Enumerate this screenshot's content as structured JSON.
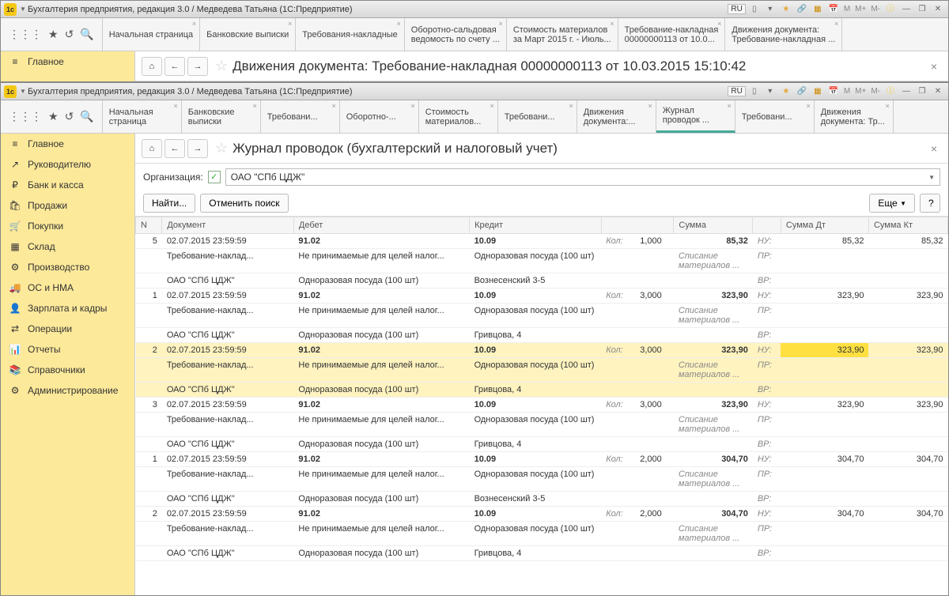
{
  "win1": {
    "title": "Бухгалтерия предприятия, редакция 3.0 / Медведева Татьяна  (1С:Предприятие)",
    "ru": "RU",
    "mem": [
      "M",
      "M+",
      "M-"
    ],
    "tabs": [
      {
        "l1": "Начальная страница",
        "l2": ""
      },
      {
        "l1": "Банковские выписки",
        "l2": ""
      },
      {
        "l1": "Требования-накладные",
        "l2": ""
      },
      {
        "l1": "Оборотно-сальдовая",
        "l2": "ведомость по счету ..."
      },
      {
        "l1": "Стоимость материалов",
        "l2": "за Март 2015 г. - Июль..."
      },
      {
        "l1": "Требование-накладная",
        "l2": "00000000113 от 10.0..."
      },
      {
        "l1": "Движения документа:",
        "l2": "Требование-накладная ..."
      }
    ],
    "side_main": "Главное",
    "page_title": "Движения документа: Требование-накладная 00000000113 от 10.03.2015 15:10:42"
  },
  "win2": {
    "title": "Бухгалтерия предприятия, редакция 3.0 / Медведева Татьяна  (1С:Предприятие)",
    "ru": "RU",
    "mem": [
      "M",
      "M+",
      "M-"
    ],
    "tabs": [
      {
        "l1": "Начальная",
        "l2": "страница"
      },
      {
        "l1": "Банковские",
        "l2": "выписки"
      },
      {
        "l1": "Требовани...",
        "l2": ""
      },
      {
        "l1": "Оборотно-...",
        "l2": ""
      },
      {
        "l1": "Стоимость",
        "l2": "материалов..."
      },
      {
        "l1": "Требовани...",
        "l2": ""
      },
      {
        "l1": "Движения",
        "l2": "документа:..."
      },
      {
        "l1": "Журнал",
        "l2": "проводок ...",
        "active": true
      },
      {
        "l1": "Требовани...",
        "l2": ""
      },
      {
        "l1": "Движения",
        "l2": "документа: Тр..."
      }
    ],
    "page_title": "Журнал проводок (бухгалтерский и налоговый учет)",
    "sidebar": [
      {
        "icon": "≡",
        "label": "Главное"
      },
      {
        "icon": "↗",
        "label": "Руководителю"
      },
      {
        "icon": "₽",
        "label": "Банк и касса"
      },
      {
        "icon": "🛍",
        "label": "Продажи"
      },
      {
        "icon": "🛒",
        "label": "Покупки"
      },
      {
        "icon": "▦",
        "label": "Склад"
      },
      {
        "icon": "⚙",
        "label": "Производство"
      },
      {
        "icon": "🚚",
        "label": "ОС и НМА"
      },
      {
        "icon": "👤",
        "label": "Зарплата и кадры"
      },
      {
        "icon": "⇄",
        "label": "Операции"
      },
      {
        "icon": "📊",
        "label": "Отчеты"
      },
      {
        "icon": "📚",
        "label": "Справочники"
      },
      {
        "icon": "⚙",
        "label": "Администрирование"
      }
    ],
    "org_label": "Организация:",
    "org_value": "ОАО \"СПб ЦДЖ\"",
    "btn_find": "Найти...",
    "btn_cancel": "Отменить поиск",
    "btn_more": "Еще",
    "headers": {
      "n": "N",
      "doc": "Документ",
      "deb": "Дебет",
      "kre": "Кредит",
      "kol": "",
      "sum": "Сумма",
      "nu": "",
      "sdt": "Сумма Дт",
      "skt": "Сумма Кт"
    },
    "labels": {
      "kol": "Кол:",
      "nu": "НУ:",
      "pr": "ПР:",
      "vr": "ВР:"
    },
    "rows": [
      {
        "n": "5",
        "date": "02.07.2015 23:59:59",
        "deb1": "91.02",
        "kre1": "10.09",
        "kol": "1,000",
        "sum": "85,32",
        "sdt": "85,32",
        "skt": "85,32",
        "doc2": "Требование-наклад...",
        "deb2": "Не принимаемые для целей налог...",
        "kre2": "Одноразовая посуда (100 шт)",
        "sum2": "Списание материалов ...",
        "doc3": "ОАО \"СПб ЦДЖ\"",
        "deb3": "Одноразовая посуда (100 шт)",
        "kre3": "Вознесенский 3-5"
      },
      {
        "n": "1",
        "date": "02.07.2015 23:59:59",
        "deb1": "91.02",
        "kre1": "10.09",
        "kol": "3,000",
        "sum": "323,90",
        "sdt": "323,90",
        "skt": "323,90",
        "doc2": "Требование-наклад...",
        "deb2": "Не принимаемые для целей налог...",
        "kre2": "Одноразовая посуда (100 шт)",
        "sum2": "Списание материалов ...",
        "doc3": "ОАО \"СПб ЦДЖ\"",
        "deb3": "Одноразовая посуда (100 шт)",
        "kre3": "Гривцова, 4"
      },
      {
        "n": "2",
        "date": "02.07.2015 23:59:59",
        "hl": true,
        "deb1": "91.02",
        "kre1": "10.09",
        "kol": "3,000",
        "sum": "323,90",
        "sdt": "323,90",
        "skt": "323,90",
        "doc2": "Требование-наклад...",
        "deb2": "Не принимаемые для целей налог...",
        "kre2": "Одноразовая посуда (100 шт)",
        "sum2": "Списание материалов ...",
        "doc3": "ОАО \"СПб ЦДЖ\"",
        "deb3": "Одноразовая посуда (100 шт)",
        "kre3": "Гривцова, 4"
      },
      {
        "n": "3",
        "date": "02.07.2015 23:59:59",
        "deb1": "91.02",
        "kre1": "10.09",
        "kol": "3,000",
        "sum": "323,90",
        "sdt": "323,90",
        "skt": "323,90",
        "doc2": "Требование-наклад...",
        "deb2": "Не принимаемые для целей налог...",
        "kre2": "Одноразовая посуда (100 шт)",
        "sum2": "Списание материалов ...",
        "doc3": "ОАО \"СПб ЦДЖ\"",
        "deb3": "Одноразовая посуда (100 шт)",
        "kre3": "Гривцова, 4"
      },
      {
        "n": "1",
        "date": "02.07.2015 23:59:59",
        "deb1": "91.02",
        "kre1": "10.09",
        "kol": "2,000",
        "sum": "304,70",
        "sdt": "304,70",
        "skt": "304,70",
        "doc2": "Требование-наклад...",
        "deb2": "Не принимаемые для целей налог...",
        "kre2": "Одноразовая посуда (100 шт)",
        "sum2": "Списание материалов ...",
        "doc3": "ОАО \"СПб ЦДЖ\"",
        "deb3": "Одноразовая посуда (100 шт)",
        "kre3": "Вознесенский 3-5"
      },
      {
        "n": "2",
        "date": "02.07.2015 23:59:59",
        "deb1": "91.02",
        "kre1": "10.09",
        "kol": "2,000",
        "sum": "304,70",
        "sdt": "304,70",
        "skt": "304,70",
        "doc2": "Требование-наклад...",
        "deb2": "Не принимаемые для целей налог...",
        "kre2": "Одноразовая посуда (100 шт)",
        "sum2": "Списание материалов ...",
        "doc3": "ОАО \"СПб ЦДЖ\"",
        "deb3": "Одноразовая посуда (100 шт)",
        "kre3": "Гривцова, 4"
      }
    ]
  }
}
